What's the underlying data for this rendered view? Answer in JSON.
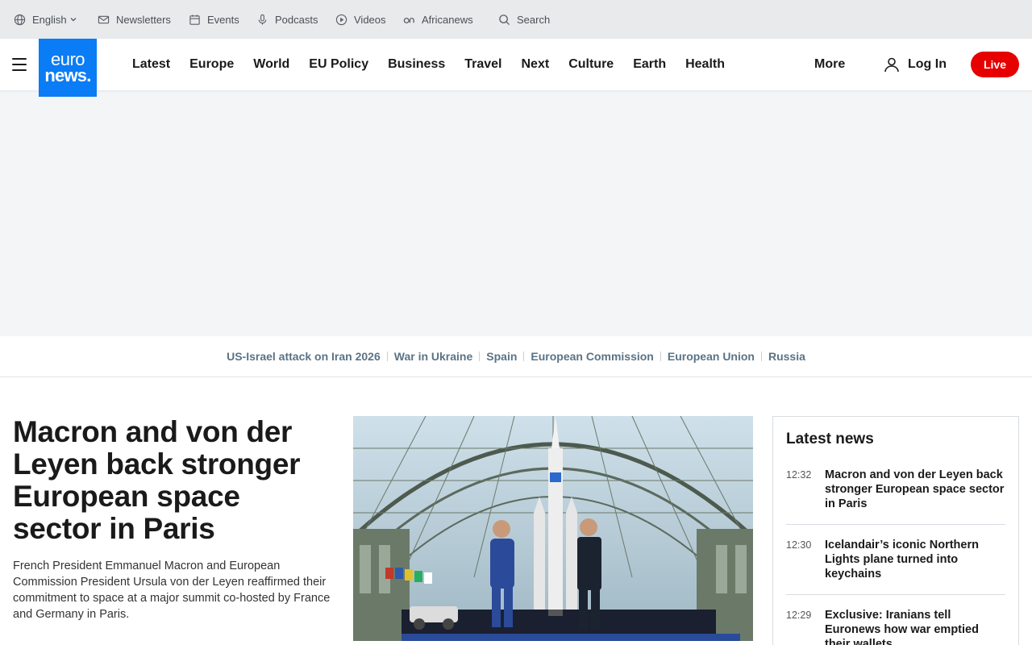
{
  "util_bar": {
    "language": "English",
    "newsletters": "Newsletters",
    "events": "Events",
    "podcasts": "Podcasts",
    "videos": "Videos",
    "africanews": "Africanews",
    "search": "Search"
  },
  "logo": {
    "top": "euro",
    "bottom": "news."
  },
  "nav": {
    "links": [
      "Latest",
      "Europe",
      "World",
      "EU Policy",
      "Business",
      "Travel",
      "Next",
      "Culture",
      "Earth",
      "Health"
    ],
    "more": "More",
    "login": "Log In",
    "live": "Live"
  },
  "topics": [
    "US-Israel attack on Iran 2026",
    "War in Ukraine",
    "Spain",
    "European Commission",
    "European Union",
    "Russia"
  ],
  "article": {
    "headline": "Macron and von der Leyen back stronger European space sector in Paris",
    "summary": "French President Emmanuel Macron and European Commission President Ursula von der Leyen reaffirmed their commitment to space at a major summit co-hosted by France and Germany in Paris."
  },
  "latest_news": {
    "title": "Latest news",
    "items": [
      {
        "time": "12:32",
        "text": "Macron and von der Leyen back stronger European space sector in Paris"
      },
      {
        "time": "12:30",
        "text": "Icelandair’s iconic Northern Lights plane turned into keychains"
      },
      {
        "time": "12:29",
        "text": "Exclusive: Iranians tell Euronews how war emptied their wallets"
      }
    ]
  },
  "colors": {
    "brand_blue": "#0a7cf5",
    "live_red": "#e60000",
    "topic_slate": "#5b7385"
  }
}
